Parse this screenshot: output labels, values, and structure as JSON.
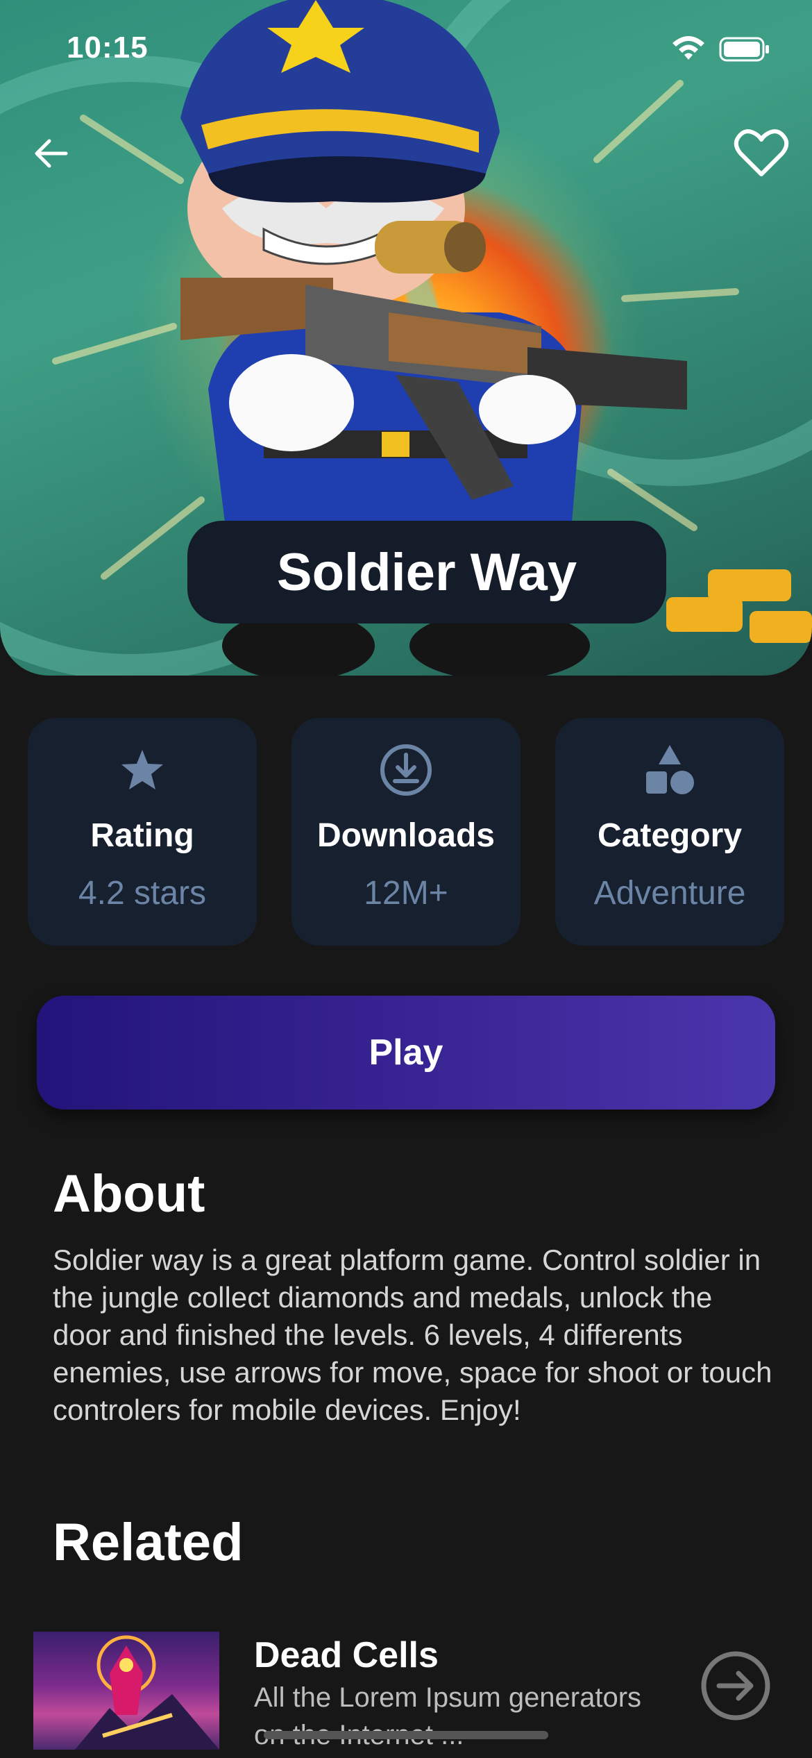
{
  "status_bar": {
    "time": "10:15"
  },
  "hero": {
    "title": "Soldier Way"
  },
  "stats": [
    {
      "label": "Rating",
      "value": "4.2 stars",
      "icon": "star-icon"
    },
    {
      "label": "Downloads",
      "value": "12M+",
      "icon": "download-icon"
    },
    {
      "label": "Category",
      "value": "Adventure",
      "icon": "shapes-icon"
    }
  ],
  "play_label": "Play",
  "about": {
    "title": "About",
    "text": "Soldier way is a great platform game. Control soldier in the jungle collect diamonds and medals, unlock the door and finished the levels. 6 levels, 4 differents enemies, use arrows for move, space for shoot or touch controlers for mobile devices. Enjoy!"
  },
  "related": {
    "title": "Related",
    "items": [
      {
        "title": "Dead Cells",
        "description": "All the Lorem Ipsum generators on the Internet ..."
      }
    ]
  },
  "colors": {
    "background": "#171717",
    "card": "#17202e",
    "stat_value": "#6c85a6",
    "play_start": "#22147a",
    "play_end": "#4a36ab"
  }
}
